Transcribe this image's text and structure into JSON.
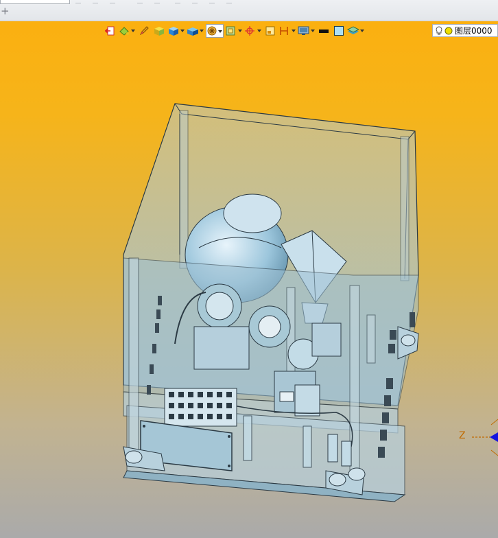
{
  "top": {
    "tab_add": "+"
  },
  "toolbar": {
    "icons": [
      "exit-sketch-icon",
      "paint-bucket-icon",
      "pencil-icon",
      "solid-box-icon",
      "blue-cube-icon",
      "face-render-icon",
      "display-mode-icon",
      "section-view-icon",
      "crosshair-icon",
      "frame-icon",
      "dimension-icon",
      "monitor-icon",
      "black-line-icon",
      "white-square-icon",
      "layer-stack-icon"
    ],
    "active_icon": "display-mode-icon"
  },
  "layer": {
    "name": "图层0000",
    "bulb_color": "#ffffff",
    "dot_color": "#f0e000"
  },
  "axis": {
    "z_label": "Z",
    "z_color": "#c06a00",
    "arrow_color": "#1414e0"
  },
  "colors": {
    "viewport_top": "#fbb010",
    "viewport_bottom": "#aaaaaa",
    "model_fill": "#a8c9d6",
    "model_edge": "#2b3a44"
  }
}
